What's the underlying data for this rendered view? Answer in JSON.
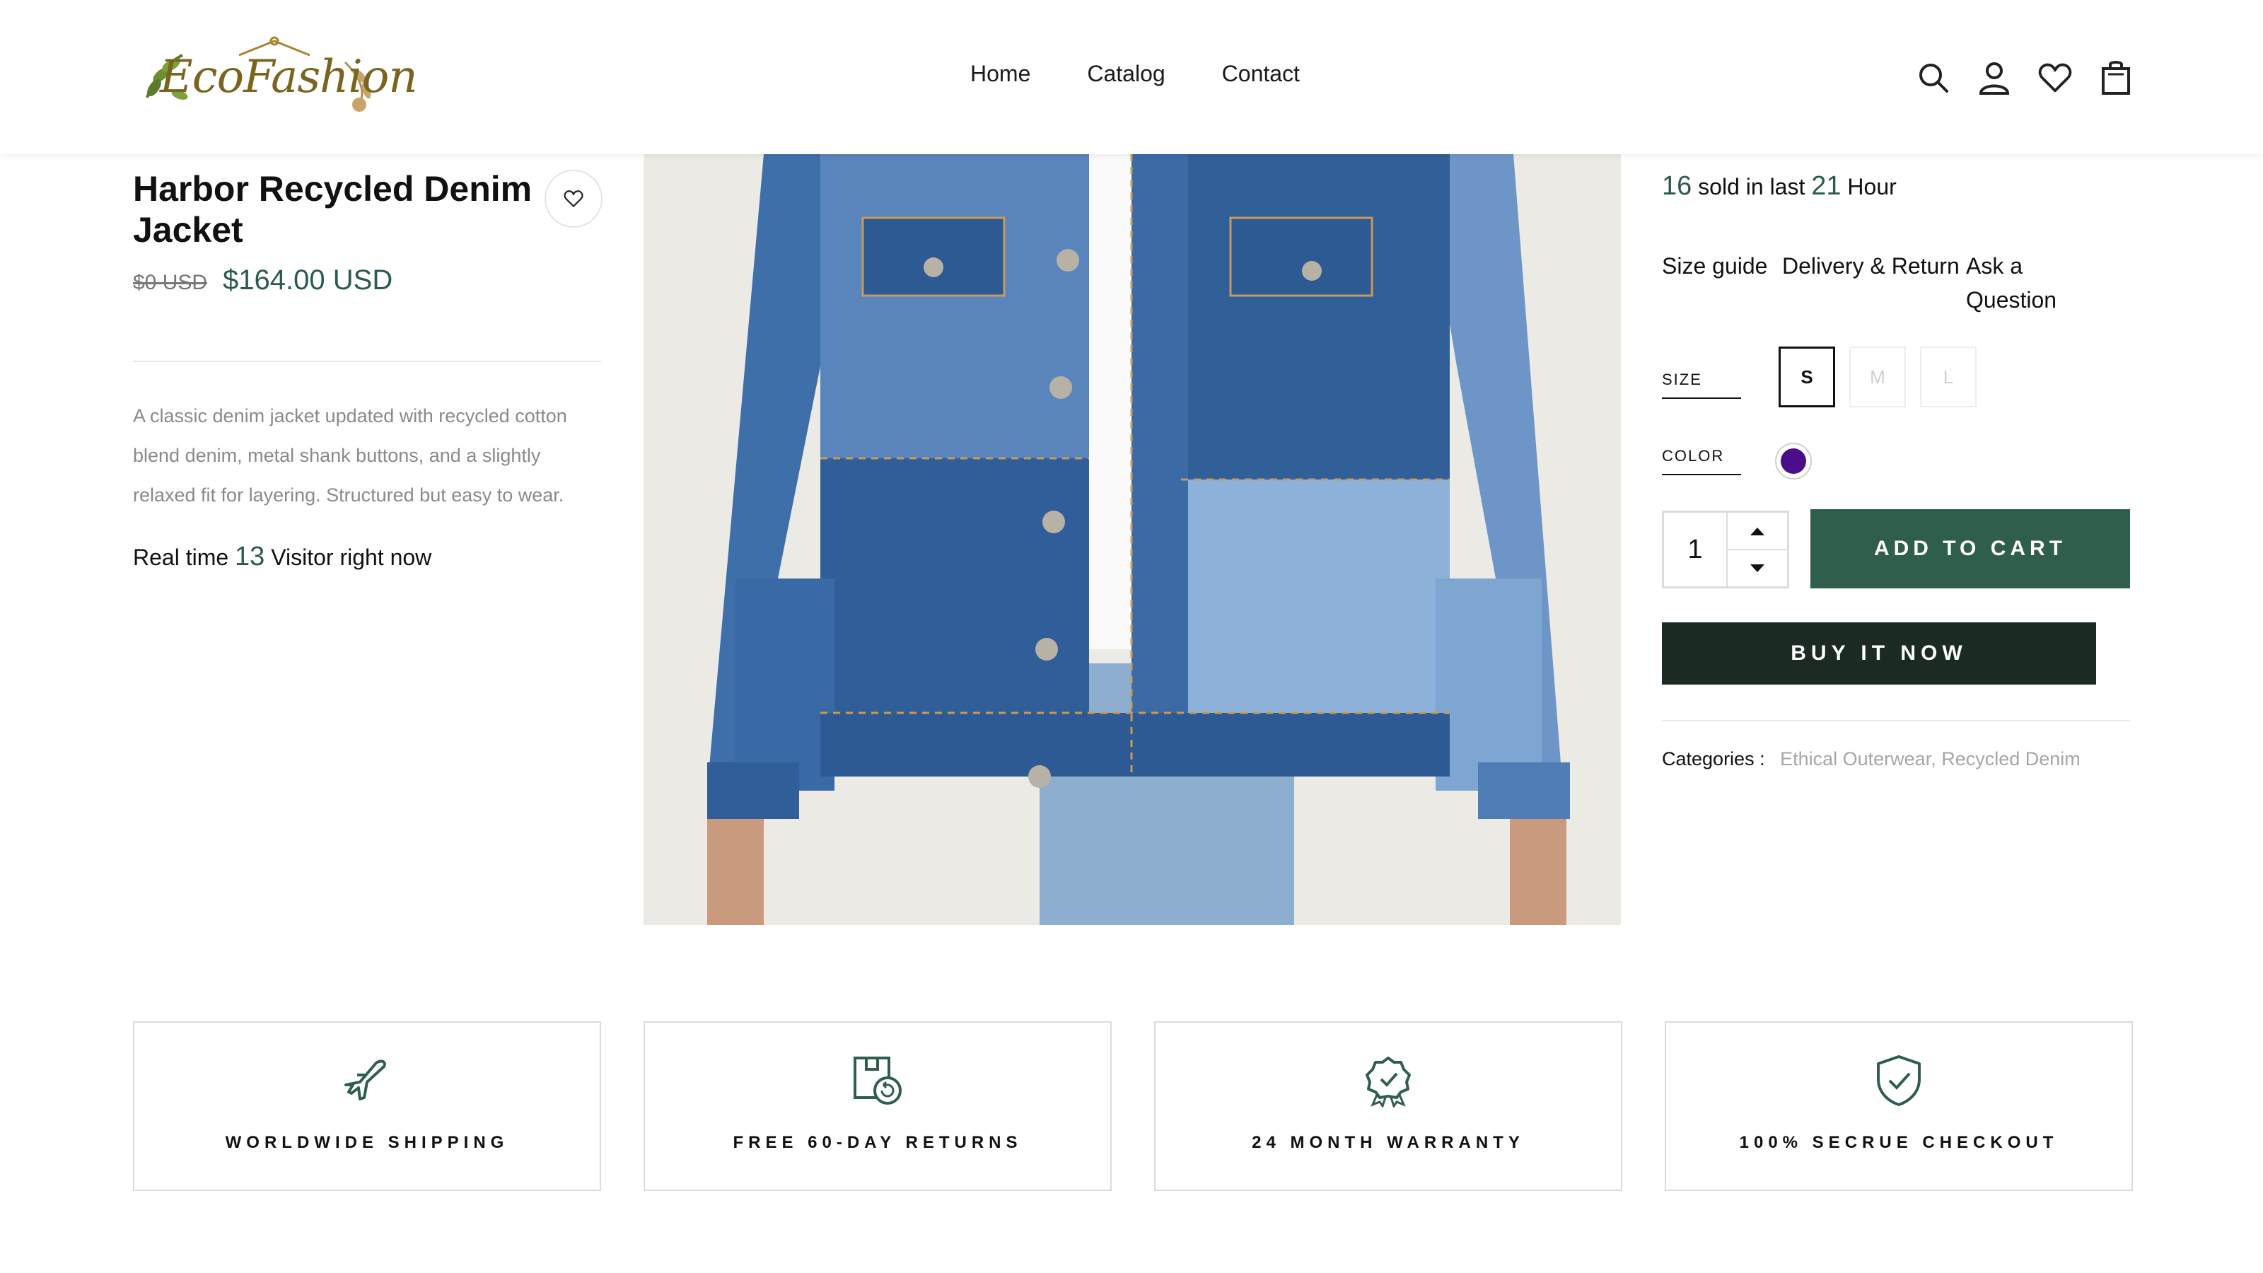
{
  "brand": {
    "logo_text": "EcoFashion"
  },
  "nav": {
    "items": [
      "Home",
      "Catalog",
      "Contact"
    ]
  },
  "header_icons": [
    "search-icon",
    "user-icon",
    "heart-icon",
    "shopping-bag-icon"
  ],
  "product": {
    "title": "Harbor Recycled Denim Jacket",
    "old_price": "$0 USD",
    "price": "$164.00 USD",
    "description": "A classic denim jacket updated with recycled cotton blend denim, metal shank buttons, and a slightly relaxed fit for layering. Structured but easy to wear.",
    "visitors": {
      "prefix": "Real time",
      "count": "13",
      "suffix": "Visitor right now"
    },
    "sold": {
      "count": "16",
      "mid": "sold in last",
      "hours": "21",
      "suffix": "Hour"
    }
  },
  "info_links": [
    "Size guide",
    "Delivery & Return",
    "Ask a Question"
  ],
  "options": {
    "size_label": "SIZE",
    "sizes": [
      "S",
      "M",
      "L"
    ],
    "selected_size": "S",
    "color_label": "COLOR",
    "color_value": "#4b0e8a"
  },
  "quantity": "1",
  "buttons": {
    "add_to_cart": "ADD TO CART",
    "buy_now": "BUY IT NOW"
  },
  "categories": {
    "label": "Categories :",
    "values": "Ethical Outerwear, Recycled Denim"
  },
  "features": [
    {
      "icon": "airplane-icon",
      "label": "WORLDWIDE SHIPPING"
    },
    {
      "icon": "return-box-icon",
      "label": "FREE 60-DAY RETURNS"
    },
    {
      "icon": "award-badge-icon",
      "label": "24 MONTH WARRANTY"
    },
    {
      "icon": "shield-check-icon",
      "label": "100% SECRUE CHECKOUT"
    }
  ],
  "colors": {
    "accent": "#2f5f4c",
    "dark": "#1b2a23",
    "price": "#2a5c48"
  }
}
